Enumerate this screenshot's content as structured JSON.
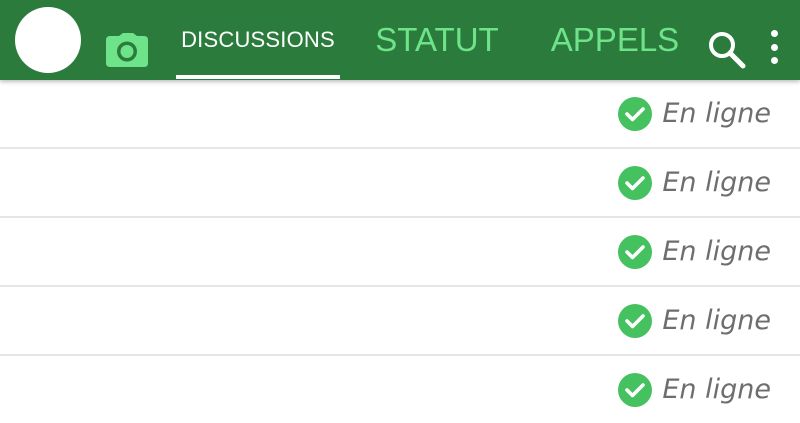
{
  "header": {
    "tabs": [
      {
        "label": "DISCUSSIONS",
        "active": true
      },
      {
        "label": "STATUT",
        "active": false
      },
      {
        "label": "APPELS",
        "active": false
      }
    ],
    "icons": {
      "camera": "camera-icon",
      "search": "search-icon",
      "menu": "more-vertical-icon"
    },
    "colors": {
      "bar": "#2b7c3c",
      "active_tab": "#ffffff",
      "inactive_tab": "#6ee389"
    }
  },
  "contacts": [
    {
      "status": "En ligne"
    },
    {
      "status": "En ligne"
    },
    {
      "status": "En ligne"
    },
    {
      "status": "En ligne"
    },
    {
      "status": "En ligne"
    }
  ],
  "status_color": "#45c15f"
}
